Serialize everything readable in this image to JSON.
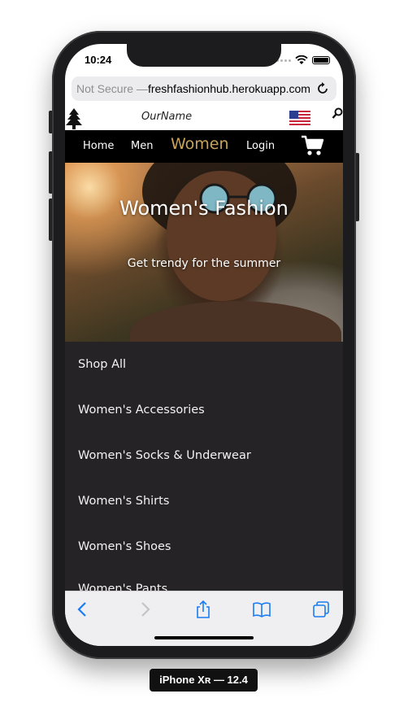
{
  "status_bar": {
    "time": "10:24"
  },
  "browser": {
    "url_prefix": "Not Secure — ",
    "url_host": "freshfashionhub.herokuapp.com"
  },
  "site": {
    "brand_name": "OurName",
    "nav": {
      "home": "Home",
      "men": "Men",
      "women": "Women",
      "login": "Login"
    },
    "hero": {
      "title": "Women's Fashion",
      "subtitle": "Get trendy for the summer"
    },
    "menu_items": [
      "Shop All",
      "Women's Accessories",
      "Women's Socks & Underwear",
      "Women's Shirts",
      "Women's Shoes",
      "Women's Pants"
    ]
  },
  "device_label": "iPhone Xʀ — 12.4",
  "colors": {
    "nav_active": "#c8a45a",
    "menu_bg": "#252326",
    "ios_blue": "#1a7cf2"
  }
}
